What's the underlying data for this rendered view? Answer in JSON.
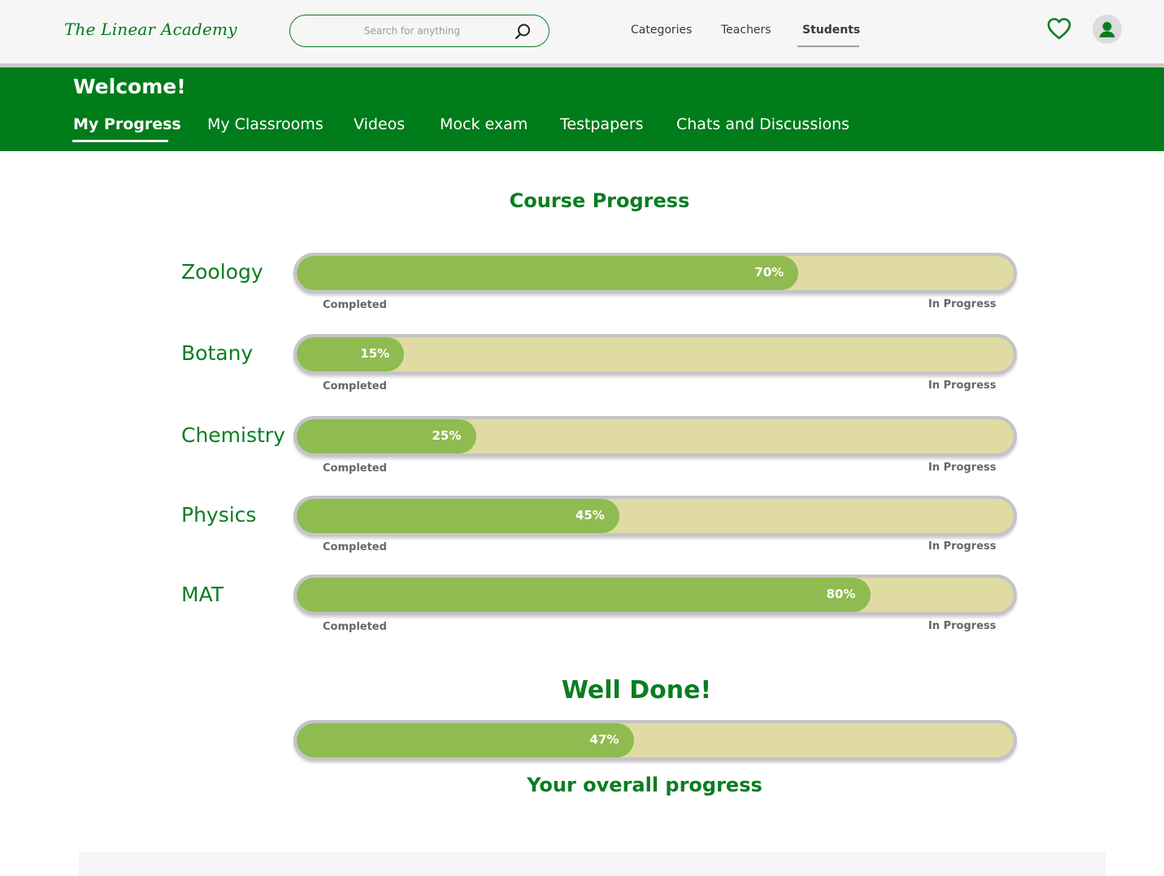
{
  "header": {
    "logo": "The Linear Academy",
    "search_placeholder": "Search for anything",
    "nav": [
      "Categories",
      "Teachers",
      "Students"
    ],
    "active_nav": "Students",
    "accent_color": "#007c1b",
    "icons": [
      "search-icon",
      "heart-icon",
      "user-icon"
    ]
  },
  "banner": {
    "welcome": "Welcome!",
    "tabs": [
      "My Progress",
      "My Classrooms",
      "Videos",
      "Mock exam",
      "Testpapers",
      "Chats and Discussions"
    ],
    "active_tab": "My Progress"
  },
  "progress": {
    "title": "Course Progress",
    "completed_label": "Completed",
    "in_progress_label": "In Progress",
    "courses": [
      {
        "name": "Zoology",
        "percent": 70,
        "percent_label": "70%"
      },
      {
        "name": "Botany",
        "percent": 15,
        "percent_label": "15%"
      },
      {
        "name": "Chemistry",
        "percent": 25,
        "percent_label": "25%"
      },
      {
        "name": "Physics",
        "percent": 45,
        "percent_label": "45%"
      },
      {
        "name": "MAT",
        "percent": 80,
        "percent_label": "80%"
      }
    ],
    "fill_color": "#8fbb50",
    "track_color": "#e0dba3"
  },
  "overall": {
    "message": "Well Done!",
    "percent": 47,
    "percent_label": "47%",
    "caption": "Your overall progress"
  }
}
